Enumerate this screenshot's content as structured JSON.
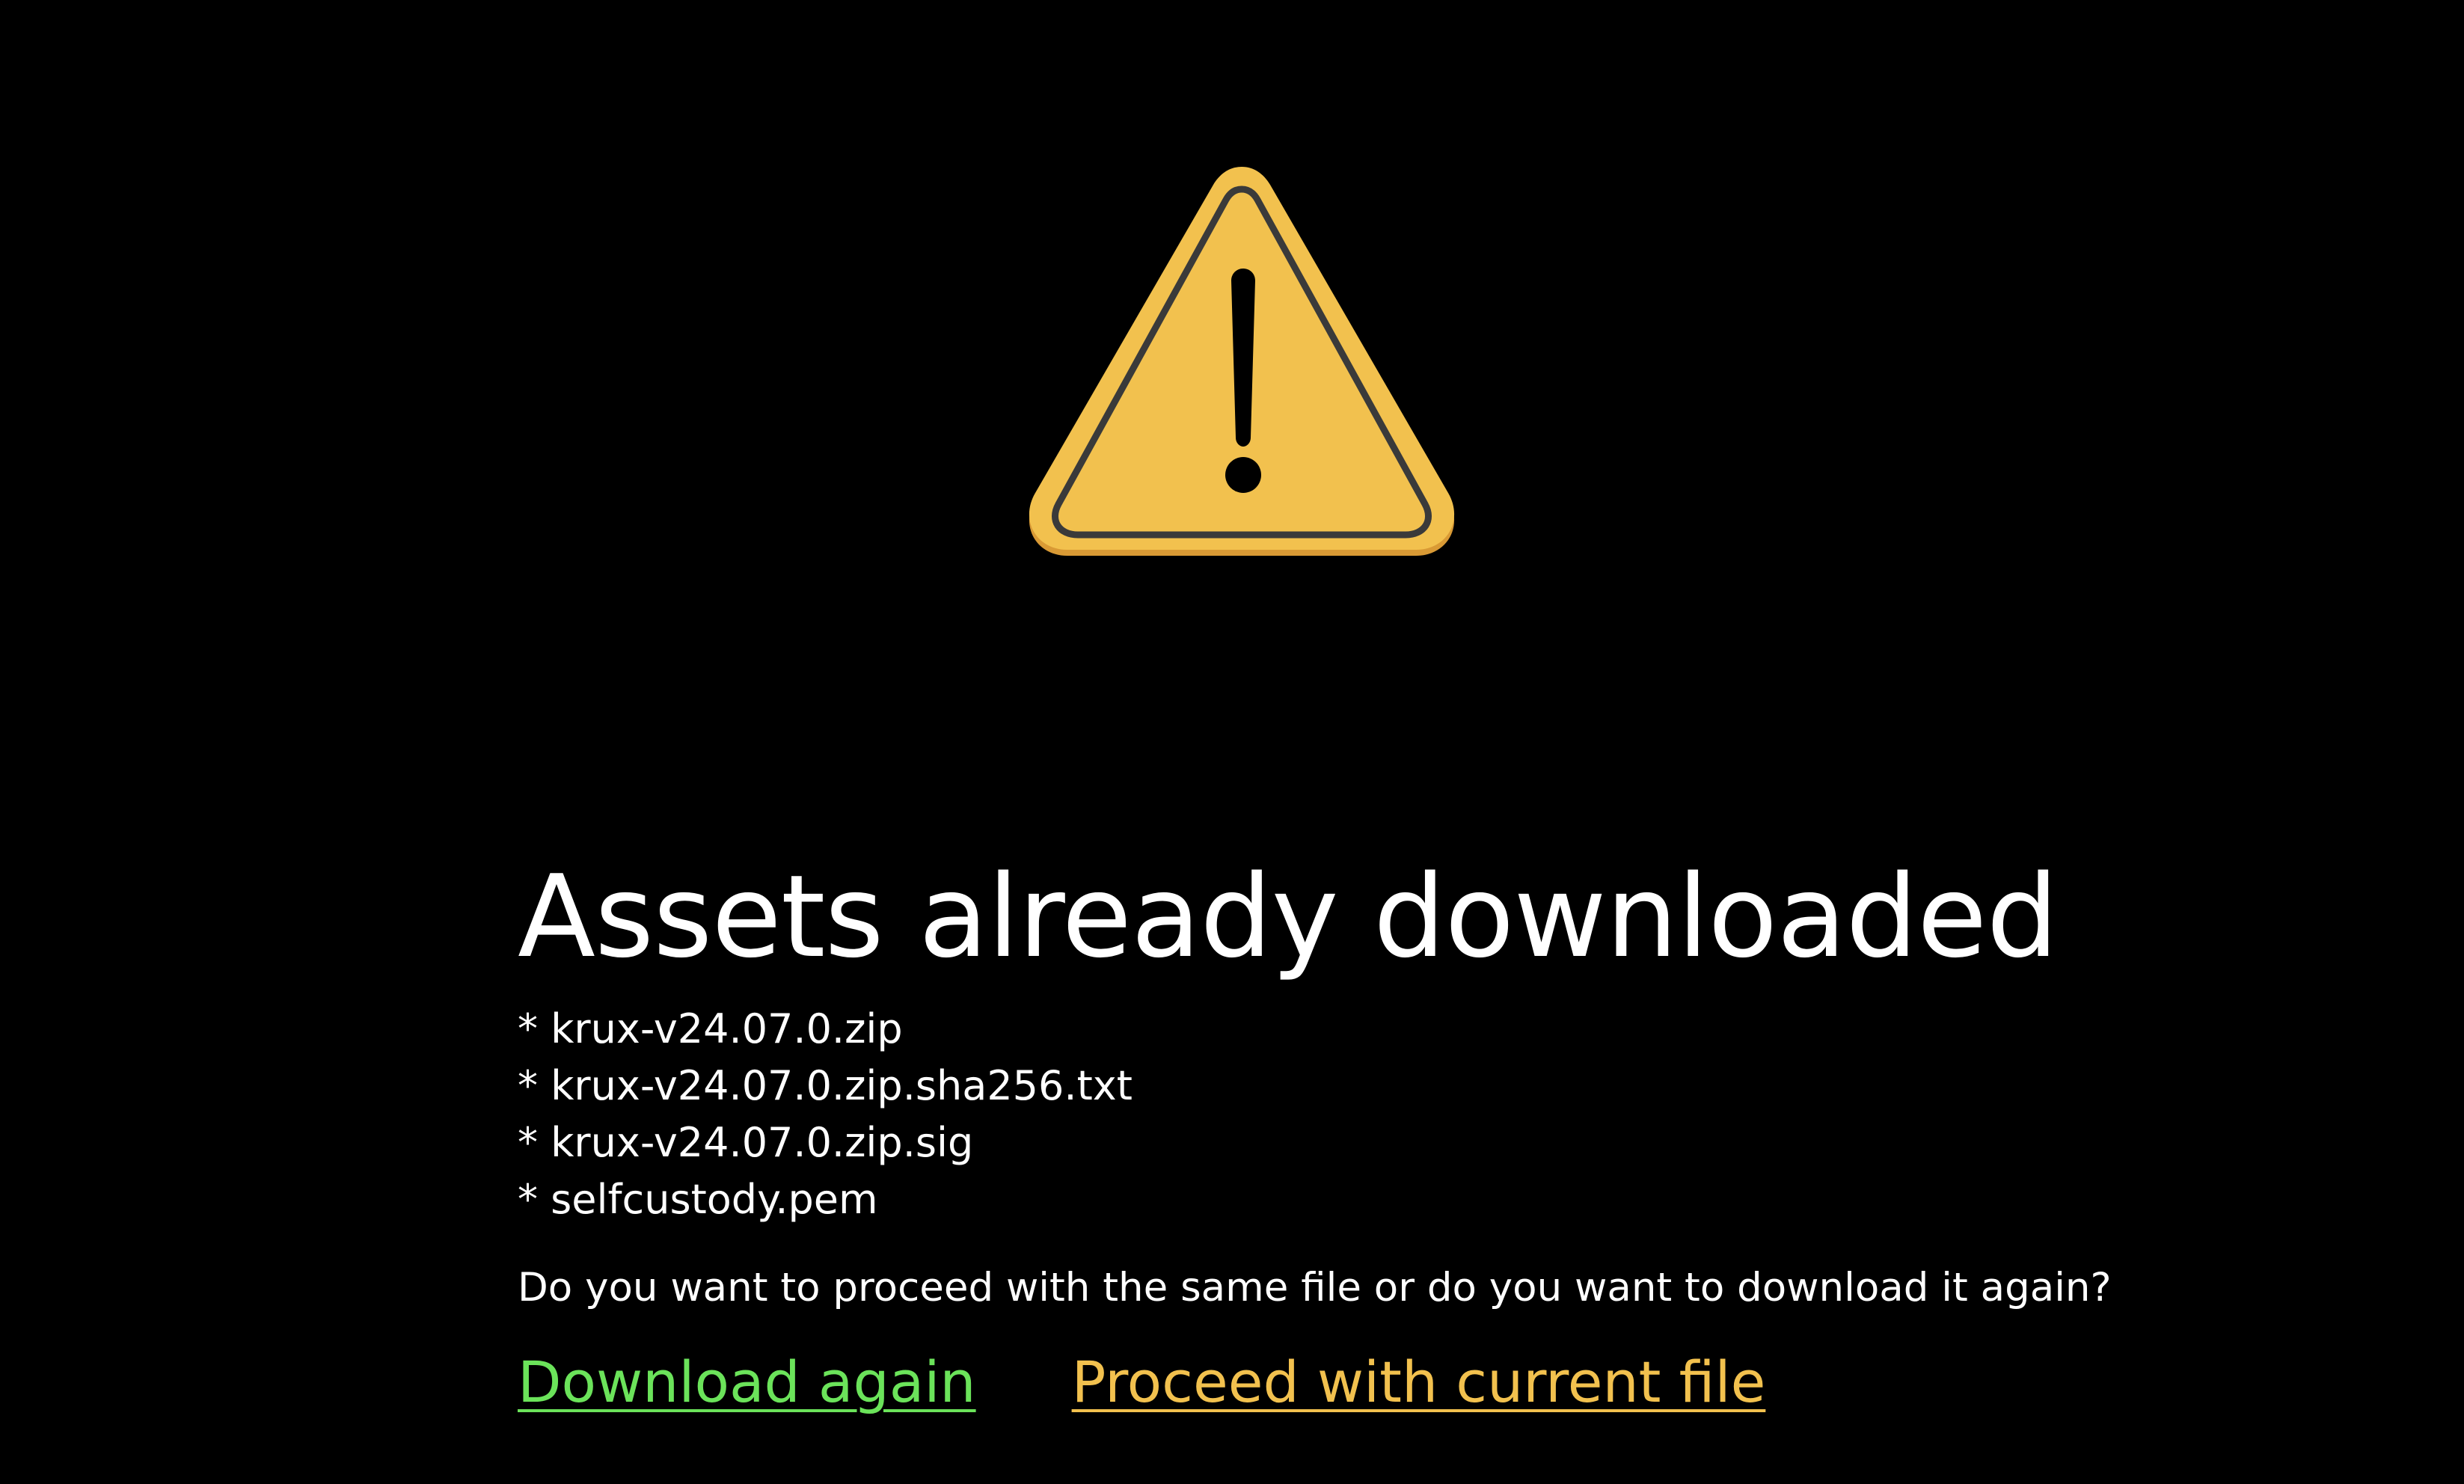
{
  "dialog": {
    "icon": "warning-triangle-icon",
    "title": "Assets already downloaded",
    "files": [
      "* krux-v24.07.0.zip",
      "* krux-v24.07.0.zip.sha256.txt",
      "* krux-v24.07.0.zip.sig",
      "* selfcustody.pem"
    ],
    "question": "Do you want to proceed with the same file or do you want to download it again?",
    "actions": {
      "download_again": "Download again",
      "proceed": "Proceed with current file"
    }
  },
  "colors": {
    "background": "#000000",
    "text": "#ffffff",
    "warning_fill": "#F2C14E",
    "warning_shadow": "#D99A35",
    "warning_stroke": "#3A3A3A",
    "download_again": "#6BE35A",
    "proceed": "#F2C14E"
  }
}
